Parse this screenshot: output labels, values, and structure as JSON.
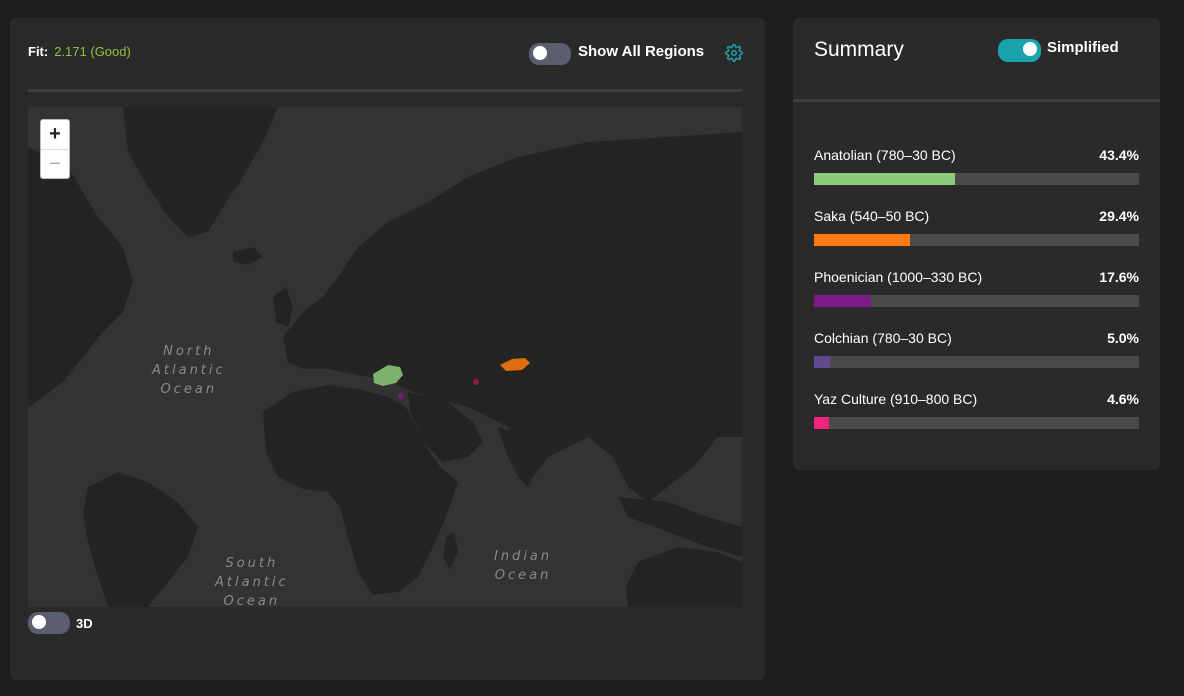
{
  "map_panel": {
    "fit_label": "Fit:",
    "fit_value": "2.171 (Good)",
    "fit_color": "#8fc43a",
    "show_all_regions_label": "Show All Regions",
    "show_all_regions_on": false,
    "settings_icon": "gear-icon",
    "zoom_in_label": "+",
    "zoom_out_label": "−",
    "ocean_labels": {
      "north_atlantic": [
        "North",
        "Atlantic",
        "Ocean"
      ],
      "south_atlantic": [
        "South",
        "Atlantic",
        "Ocean"
      ],
      "indian": [
        "Indian",
        "Ocean"
      ]
    },
    "three_d_label": "3D",
    "three_d_on": false
  },
  "summary": {
    "title": "Summary",
    "simplified_label": "Simplified",
    "simplified_on": true,
    "items": [
      {
        "name": "Anatolian (780–30 BC)",
        "pct_label": "43.4%",
        "pct": 43.4,
        "color": "#8cc97a"
      },
      {
        "name": "Saka (540–50 BC)",
        "pct_label": "29.4%",
        "pct": 29.4,
        "color": "#ff7a0d"
      },
      {
        "name": "Phoenician (1000–330 BC)",
        "pct_label": "17.6%",
        "pct": 17.6,
        "color": "#7e1a86"
      },
      {
        "name": "Colchian (780–30 BC)",
        "pct_label": "5.0%",
        "pct": 5.0,
        "color": "#5e4a8c"
      },
      {
        "name": "Yaz Culture (910–800 BC)",
        "pct_label": "4.6%",
        "pct": 4.6,
        "color": "#f0267a"
      }
    ]
  }
}
